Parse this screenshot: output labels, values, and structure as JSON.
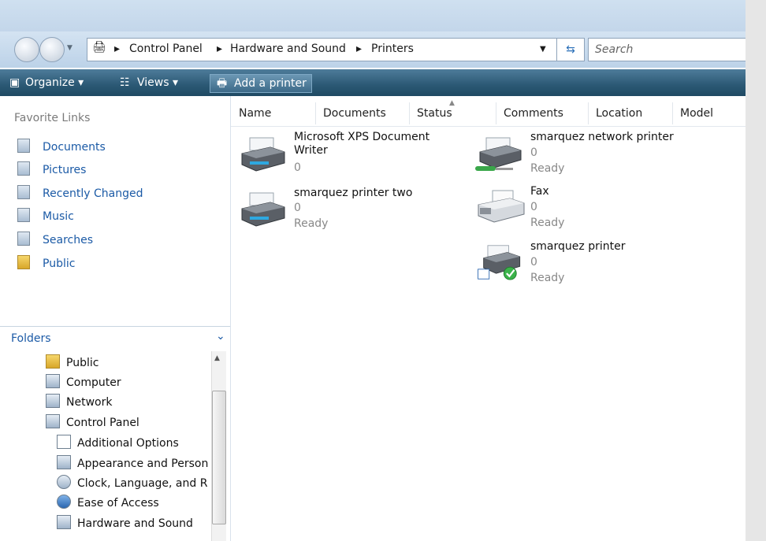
{
  "window": {
    "title": ""
  },
  "address": {
    "segments": [
      "Control Panel",
      "Hardware and Sound",
      "Printers"
    ],
    "separator": "▸",
    "search_placeholder": "Search"
  },
  "toolbar": {
    "organize": "Organize ▾",
    "views": "Views ▾",
    "add_printer": "Add a printer"
  },
  "favorites": {
    "heading": "Favorite Links",
    "items": [
      "Documents",
      "Pictures",
      "Recently Changed",
      "Music",
      "Searches",
      "Public"
    ]
  },
  "folders": {
    "heading": "Folders",
    "items": [
      "Public",
      "Computer",
      "Network",
      "Control Panel",
      "Additional Options",
      "Appearance and Person",
      "Clock, Language, and R",
      "Ease of Access",
      "Hardware and Sound"
    ]
  },
  "columns": [
    "Name",
    "Documents",
    "Status",
    "Comments",
    "Location",
    "Model"
  ],
  "printers": [
    {
      "name": "Microsoft XPS Document Writer",
      "docs": "0",
      "status": ""
    },
    {
      "name": "smarquez printer two",
      "docs": "0",
      "status": "Ready"
    },
    {
      "name": "smarquez network printer",
      "docs": "0",
      "status": "Ready"
    },
    {
      "name": "Fax",
      "docs": "0",
      "status": "Ready"
    },
    {
      "name": "smarquez printer",
      "docs": "0",
      "status": "Ready"
    }
  ]
}
